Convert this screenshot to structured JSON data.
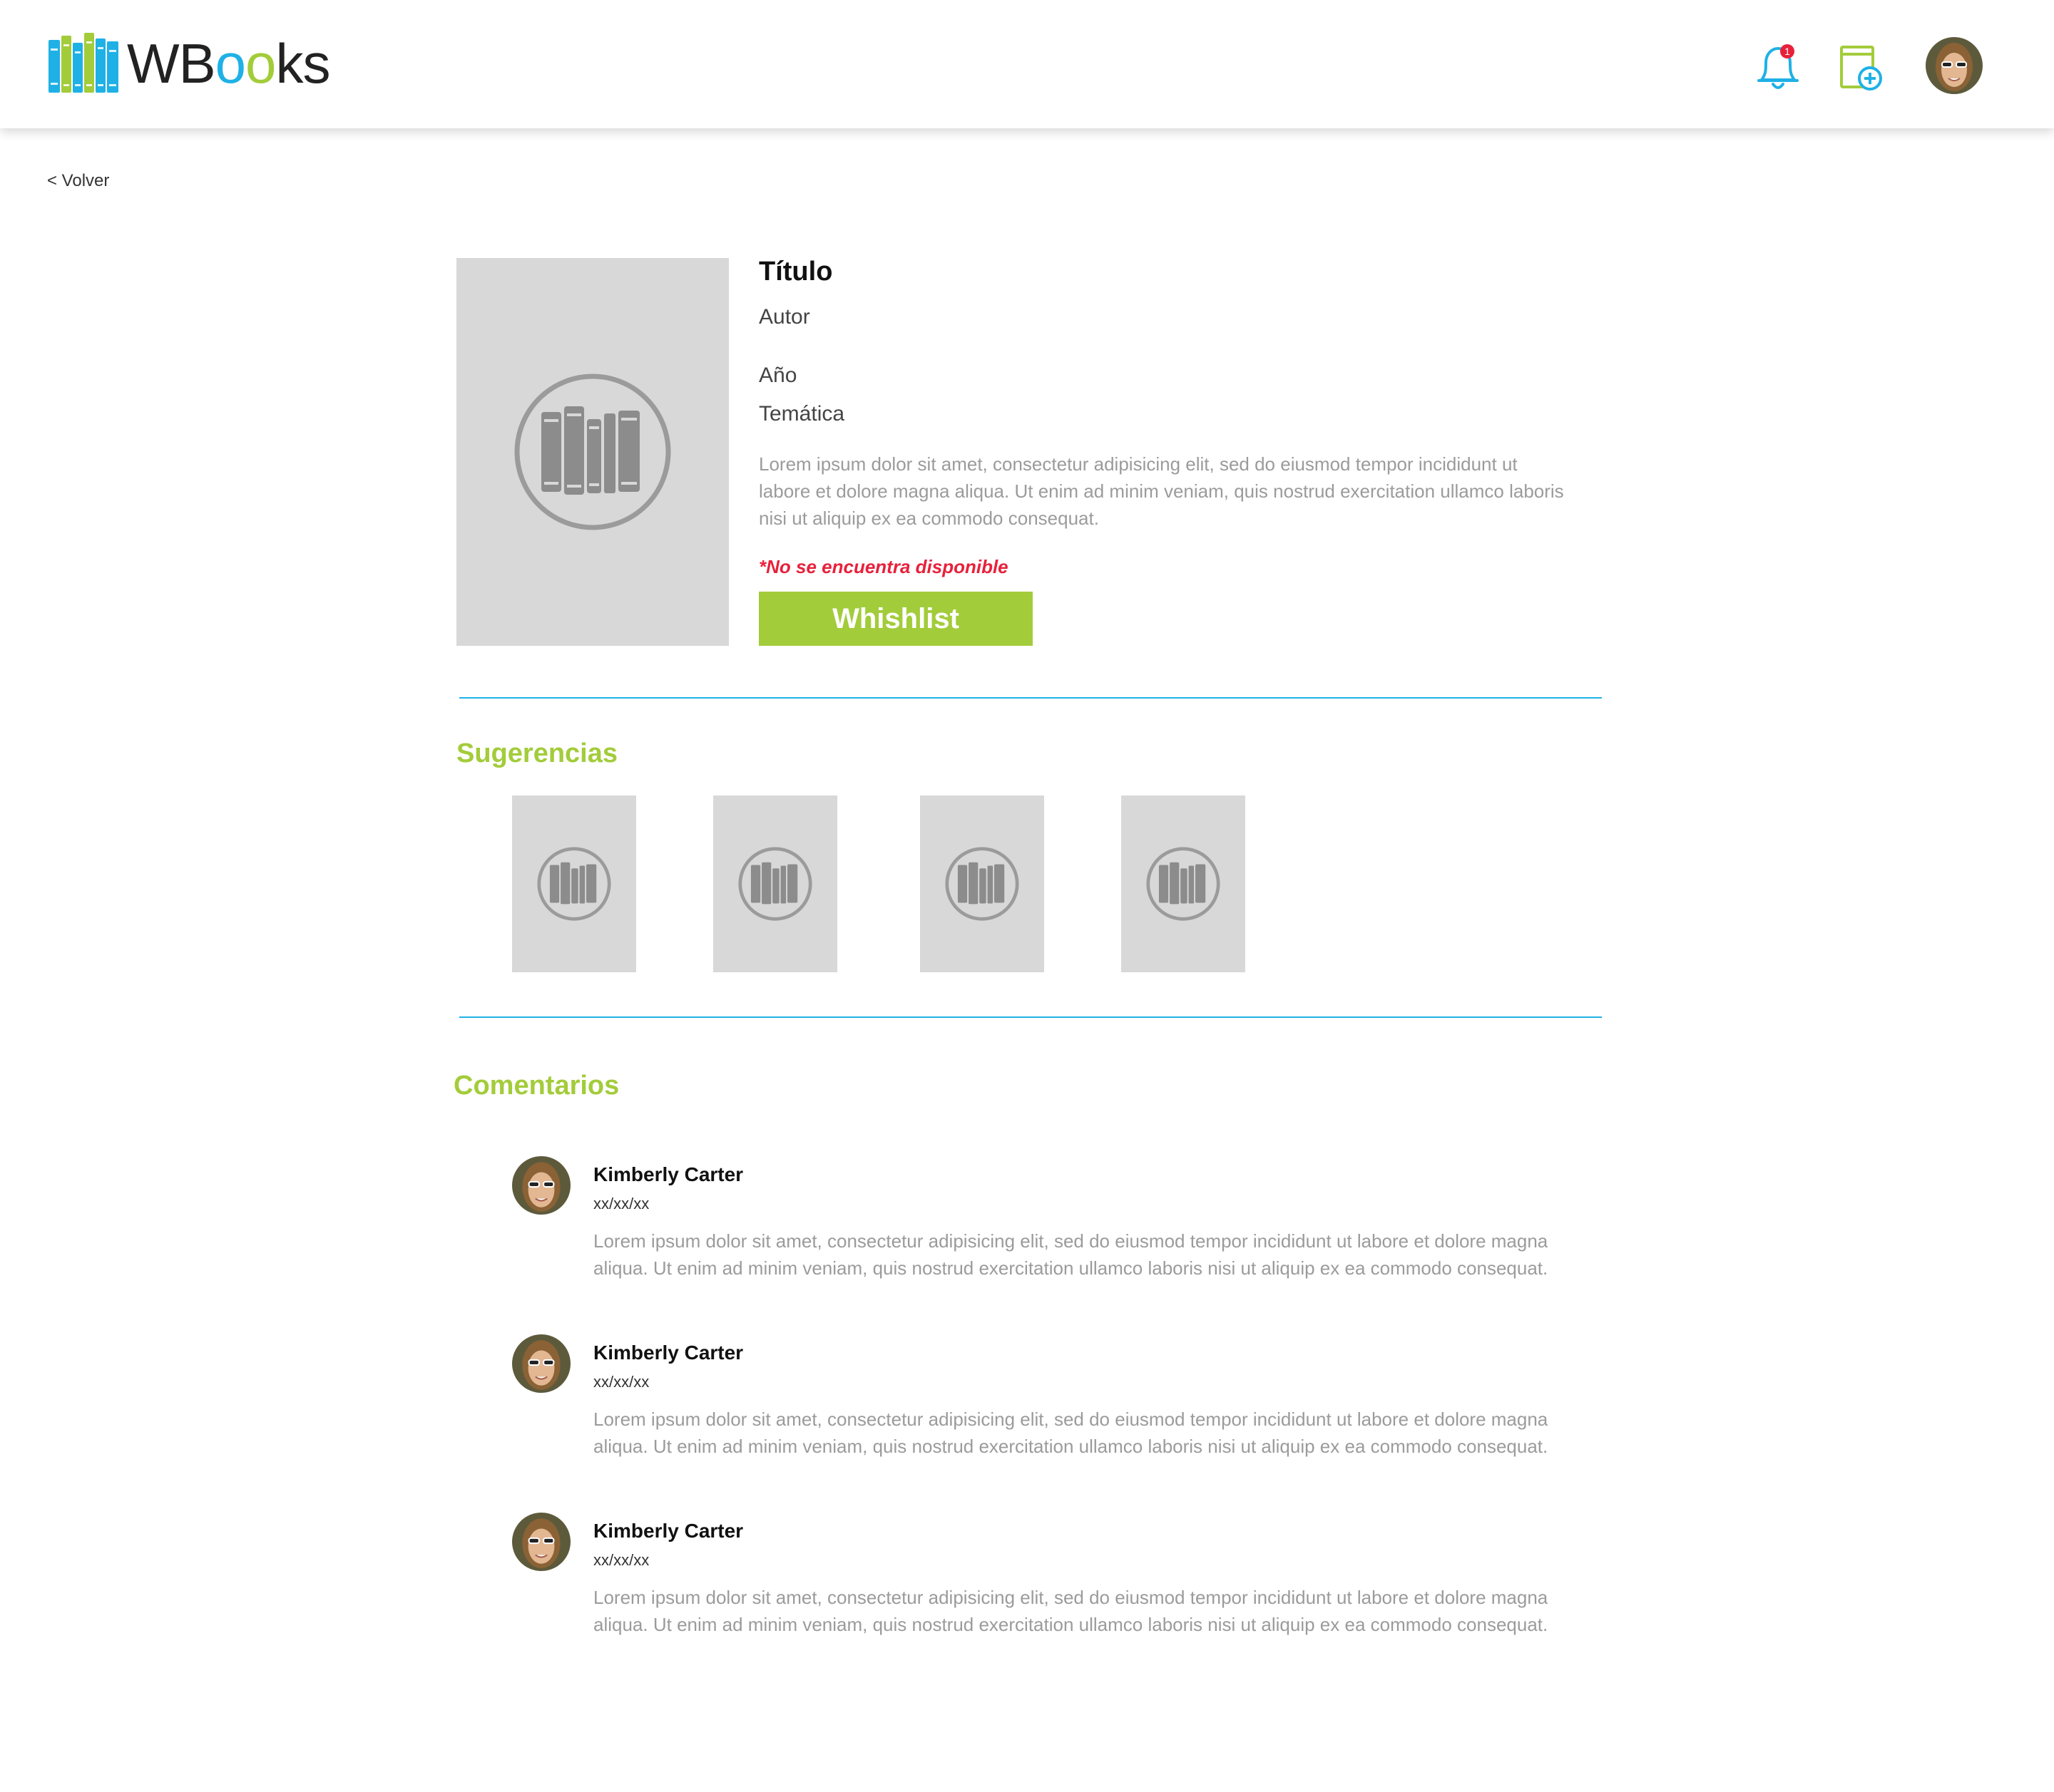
{
  "header": {
    "logo": {
      "part1": "WB",
      "part2": "o",
      "part3": "o",
      "part4": "ks"
    },
    "notification_count": "1",
    "icons": [
      "bell-icon",
      "add-book-icon",
      "avatar"
    ]
  },
  "nav": {
    "back_label": "< Volver"
  },
  "book": {
    "title": "Título",
    "author": "Autor",
    "year": "Año",
    "topic": "Temática",
    "description": "Lorem ipsum dolor sit amet, consectetur adipisicing elit, sed do eiusmod tempor incididunt ut labore et dolore magna aliqua. Ut enim ad minim veniam, quis nostrud exercitation ullamco laboris nisi ut aliquip ex ea commodo consequat.",
    "availability": "*No se encuentra disponible",
    "wishlist_label": "Whishlist"
  },
  "suggestions": {
    "title": "Sugerencias",
    "count_items": 4
  },
  "comments": {
    "title": "Comentarios",
    "items": [
      {
        "name": "Kimberly Carter",
        "date": "xx/xx/xx",
        "text": "Lorem ipsum dolor sit amet, consectetur adipisicing elit, sed do eiusmod tempor incididunt ut labore et dolore magna aliqua. Ut enim ad minim veniam, quis nostrud exercitation ullamco laboris nisi ut aliquip ex ea commodo consequat."
      },
      {
        "name": "Kimberly Carter",
        "date": "xx/xx/xx",
        "text": "Lorem ipsum dolor sit amet, consectetur adipisicing elit, sed do eiusmod tempor incididunt ut labore et dolore magna aliqua. Ut enim ad minim veniam, quis nostrud exercitation ullamco laboris nisi ut aliquip ex ea commodo consequat."
      },
      {
        "name": "Kimberly Carter",
        "date": "xx/xx/xx",
        "text": "Lorem ipsum dolor sit amet, consectetur adipisicing elit, sed do eiusmod tempor incididunt ut labore et dolore magna aliqua. Ut enim ad minim veniam, quis nostrud exercitation ullamco laboris nisi ut aliquip ex ea commodo consequat."
      }
    ]
  },
  "colors": {
    "brand_blue": "#1fb1e6",
    "brand_green": "#a3cc3a",
    "alert_red": "#e8213b",
    "placeholder_gray": "#d8d8d8"
  }
}
